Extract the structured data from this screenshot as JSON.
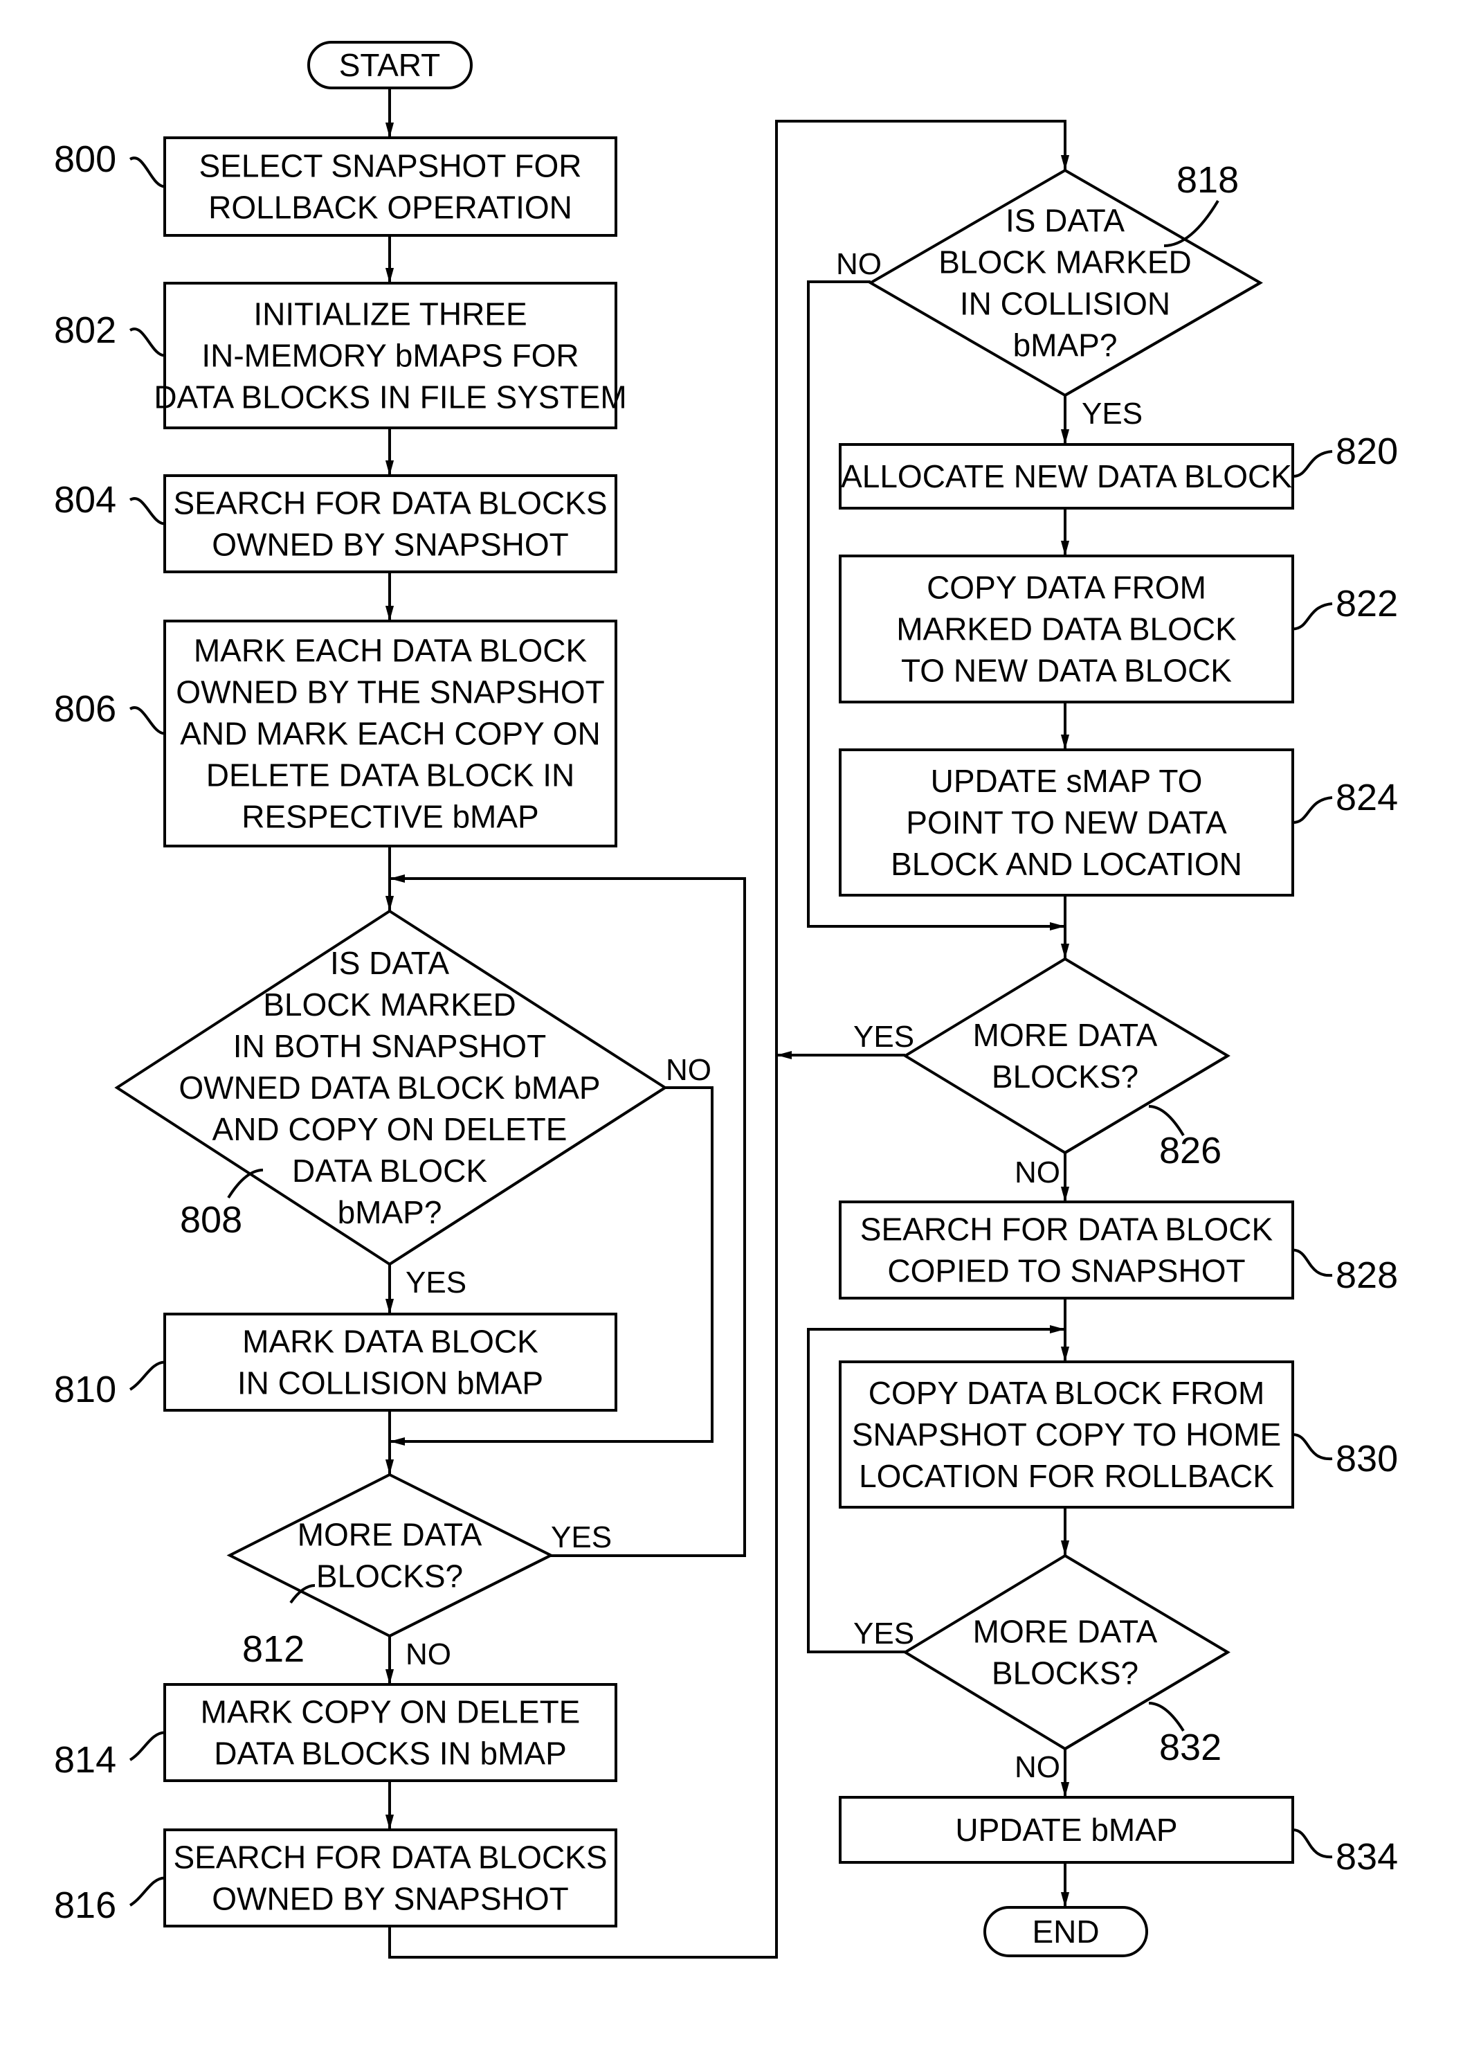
{
  "figure": {
    "terminals": {
      "start": "START",
      "end": "END"
    },
    "steps": [
      {
        "id": "800",
        "lines": [
          "SELECT SNAPSHOT FOR",
          "ROLLBACK OPERATION"
        ]
      },
      {
        "id": "802",
        "lines": [
          "INITIALIZE THREE",
          "IN-MEMORY bMAPS FOR",
          "DATA BLOCKS IN FILE SYSTEM"
        ]
      },
      {
        "id": "804",
        "lines": [
          "SEARCH FOR DATA BLOCKS",
          "OWNED BY SNAPSHOT"
        ]
      },
      {
        "id": "806",
        "lines": [
          "MARK EACH DATA BLOCK",
          "OWNED BY THE SNAPSHOT",
          "AND MARK EACH COPY ON",
          "DELETE DATA BLOCK IN",
          "RESPECTIVE bMAP"
        ]
      },
      {
        "id": "808",
        "lines": [
          "IS DATA",
          "BLOCK MARKED",
          "IN BOTH SNAPSHOT",
          "OWNED DATA BLOCK bMAP",
          "AND COPY ON DELETE",
          "DATA BLOCK",
          "bMAP?"
        ]
      },
      {
        "id": "810",
        "lines": [
          "MARK DATA BLOCK",
          "IN COLLISION bMAP"
        ]
      },
      {
        "id": "812",
        "lines": [
          "MORE DATA",
          "BLOCKS?"
        ]
      },
      {
        "id": "814",
        "lines": [
          "MARK COPY ON DELETE",
          "DATA BLOCKS IN bMAP"
        ]
      },
      {
        "id": "816",
        "lines": [
          "SEARCH FOR DATA BLOCKS",
          "OWNED BY SNAPSHOT"
        ]
      },
      {
        "id": "818",
        "lines": [
          "IS DATA",
          "BLOCK MARKED",
          "IN COLLISION",
          "bMAP?"
        ]
      },
      {
        "id": "820",
        "lines": [
          "ALLOCATE NEW DATA BLOCK"
        ]
      },
      {
        "id": "822",
        "lines": [
          "COPY DATA FROM",
          "MARKED DATA BLOCK",
          "TO NEW DATA BLOCK"
        ]
      },
      {
        "id": "824",
        "lines": [
          "UPDATE sMAP TO",
          "POINT TO NEW DATA",
          "BLOCK AND LOCATION"
        ]
      },
      {
        "id": "826",
        "lines": [
          "MORE DATA",
          "BLOCKS?"
        ]
      },
      {
        "id": "828",
        "lines": [
          "SEARCH FOR DATA BLOCK",
          "COPIED TO SNAPSHOT"
        ]
      },
      {
        "id": "830",
        "lines": [
          "COPY DATA BLOCK FROM",
          "SNAPSHOT COPY TO HOME",
          "LOCATION FOR ROLLBACK"
        ]
      },
      {
        "id": "832",
        "lines": [
          "MORE DATA",
          "BLOCKS?"
        ]
      },
      {
        "id": "834",
        "lines": [
          "UPDATE bMAP"
        ]
      }
    ],
    "branch_labels": {
      "yes": "YES",
      "no": "NO"
    }
  }
}
